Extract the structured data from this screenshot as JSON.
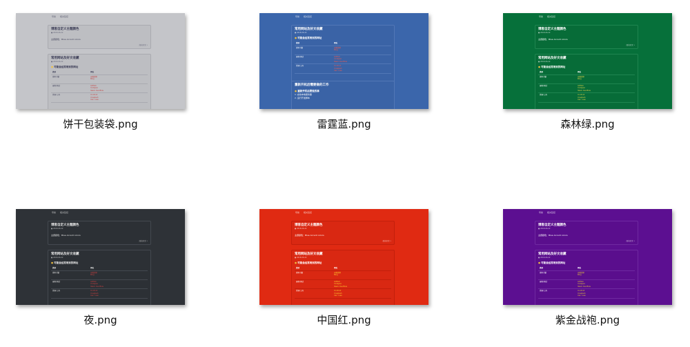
{
  "files": [
    {
      "name": "饼干包装袋.png",
      "bg": "#c4c5c9",
      "card": "#bdbec2",
      "border": "#a9aab0",
      "text": "#3a3b55",
      "accent": "#c44040",
      "mini": {
        "nav": [
          "导航",
          "相关链接"
        ],
        "card1_title": "博客自定义主题颜色",
        "card1_sub": "● 2018-06-22",
        "card1_line": "主题颜色：Blue Accent colors",
        "card1_link": "阅读全文 »",
        "card2_title": "常用网站及好文收藏",
        "card2_sub": "● 2018-06-22",
        "card2_section": "可能会经常用到的网址",
        "table_head": [
          "类别",
          "网址"
        ],
        "table_rows": [
          {
            "cat": "搜索引擎",
            "links": [
              "谷歌搜索",
              "Bing"
            ]
          },
          {
            "cat": "编程/测试",
            "links": [
              "GitHub",
              "Codepen",
              "Stack Overflow"
            ]
          },
          {
            "cat": "资源/工具",
            "links": [
              "Iconfont",
              "Unsplash",
              "Can I use"
            ]
          }
        ],
        "card3_title": "",
        "card3_section": "",
        "card3_lines": []
      }
    },
    {
      "name": "雷霆蓝.png",
      "bg": "#3b66ab",
      "card": "#3a63a6",
      "border": "#5277b6",
      "text": "#ffffff",
      "accent": "#ff5a48",
      "mini": {
        "nav": [
          "导航",
          "相关链接"
        ],
        "card1_title": "常用网站及好文收藏",
        "card1_sub": "● 2018-06-22",
        "card1_line": "",
        "card1_link": "",
        "card2_title": "",
        "card2_sub": "",
        "card2_section": "可能会经常用到的网址",
        "table_head": [
          "类别",
          "网址"
        ],
        "table_rows": [
          {
            "cat": "搜索引擎",
            "links": [
              "谷歌搜索",
              "Bing"
            ]
          },
          {
            "cat": "编程/测试",
            "links": [
              "GitHub",
              "Codepen",
              "Stack Overflow"
            ]
          },
          {
            "cat": "资源/工具",
            "links": [
              "Iconfont",
              "Unsplash",
              "Can I use"
            ]
          }
        ],
        "card3_title": "重新开机后需要做的工作",
        "card3_section": "重新开机后要做的事",
        "card3_lines": [
          "1. 启动本地服务器",
          "2. 运行开发脚本"
        ]
      }
    },
    {
      "name": "森林绿.png",
      "bg": "#06703a",
      "card": "#076c38",
      "border": "#1f8550",
      "text": "#ffffff",
      "accent": "#e4d24a",
      "mini": {
        "nav": [
          "导航",
          "相关链接"
        ],
        "card1_title": "博客自定义主题颜色",
        "card1_sub": "● 2018-06-22",
        "card1_line": "主题颜色：Blue Accent colors",
        "card1_link": "阅读全文 »",
        "card2_title": "常用网站及好文收藏",
        "card2_sub": "● 2018-06-22",
        "card2_section": "可能会经常用到的网址",
        "table_head": [
          "类别",
          "网址"
        ],
        "table_rows": [
          {
            "cat": "搜索引擎",
            "links": [
              "谷歌搜索",
              "Bing"
            ]
          },
          {
            "cat": "编程/测试",
            "links": [
              "GitHub",
              "Codepen",
              "Stack Overflow"
            ]
          },
          {
            "cat": "资源/工具",
            "links": [
              "Iconfont",
              "Unsplash",
              "Can I use"
            ]
          }
        ],
        "card3_title": "",
        "card3_section": "",
        "card3_lines": []
      }
    },
    {
      "name": "夜.png",
      "bg": "#2e3237",
      "card": "#2c3035",
      "border": "#444950",
      "text": "#e8e8e8",
      "accent": "#d04040",
      "mini": {
        "nav": [
          "导航",
          "相关链接"
        ],
        "card1_title": "博客自定义主题颜色",
        "card1_sub": "● 2018-06-22",
        "card1_line": "主题颜色：Blue Accent colors",
        "card1_link": "阅读全文 »",
        "card2_title": "常用网站及好文收藏",
        "card2_sub": "● 2018-06-22",
        "card2_section": "可能会经常用到的网址",
        "table_head": [
          "类别",
          "网址"
        ],
        "table_rows": [
          {
            "cat": "搜索引擎",
            "links": [
              "谷歌搜索",
              "Bing"
            ]
          },
          {
            "cat": "编程/测试",
            "links": [
              "GitHub",
              "Codepen",
              "Stack Overflow"
            ]
          },
          {
            "cat": "资源/工具",
            "links": [
              "Iconfont",
              "Unsplash",
              "Can I use"
            ]
          }
        ],
        "card3_title": "",
        "card3_section": "",
        "card3_lines": []
      }
    },
    {
      "name": "中国红.png",
      "bg": "#e02a12",
      "card": "#d92812",
      "border": "#c21f0c",
      "text": "#ffffff",
      "accent": "#ffd22e",
      "mini": {
        "nav": [
          "导航",
          "相关链接"
        ],
        "card1_title": "博客自定义主题颜色",
        "card1_sub": "● 2018-06-22",
        "card1_line": "主题颜色：Blue Accent colors",
        "card1_link": "阅读全文 »",
        "card2_title": "常用网站及好文收藏",
        "card2_sub": "● 2018-06-22",
        "card2_section": "可能会经常用到的网址",
        "table_head": [
          "类别",
          "网址"
        ],
        "table_rows": [
          {
            "cat": "搜索引擎",
            "links": [
              "谷歌搜索",
              "Bing"
            ]
          },
          {
            "cat": "编程/测试",
            "links": [
              "GitHub",
              "Codepen",
              "Stack Overflow"
            ]
          },
          {
            "cat": "资源/工具",
            "links": [
              "Iconfont",
              "Unsplash",
              "Can I use"
            ]
          }
        ],
        "card3_title": "",
        "card3_section": "",
        "card3_lines": []
      }
    },
    {
      "name": "紫金战袍.png",
      "bg": "#5c0f91",
      "card": "#5a0e8d",
      "border": "#6f2aa1",
      "text": "#ffffff",
      "accent": "#e4c53a",
      "mini": {
        "nav": [
          "导航",
          "相关链接"
        ],
        "card1_title": "博客自定义主题颜色",
        "card1_sub": "● 2018-06-22",
        "card1_line": "主题颜色：Blue Accent colors",
        "card1_link": "阅读全文 »",
        "card2_title": "常用网站及好文收藏",
        "card2_sub": "● 2018-06-22",
        "card2_section": "可能会经常用到的网址",
        "table_head": [
          "类别",
          "网址"
        ],
        "table_rows": [
          {
            "cat": "搜索引擎",
            "links": [
              "谷歌搜索",
              "Bing"
            ]
          },
          {
            "cat": "编程/测试",
            "links": [
              "GitHub",
              "Codepen",
              "Stack Overflow"
            ]
          },
          {
            "cat": "资源/工具",
            "links": [
              "Iconfont",
              "Unsplash",
              "Can I use"
            ]
          }
        ],
        "card3_title": "",
        "card3_section": "",
        "card3_lines": []
      }
    }
  ]
}
